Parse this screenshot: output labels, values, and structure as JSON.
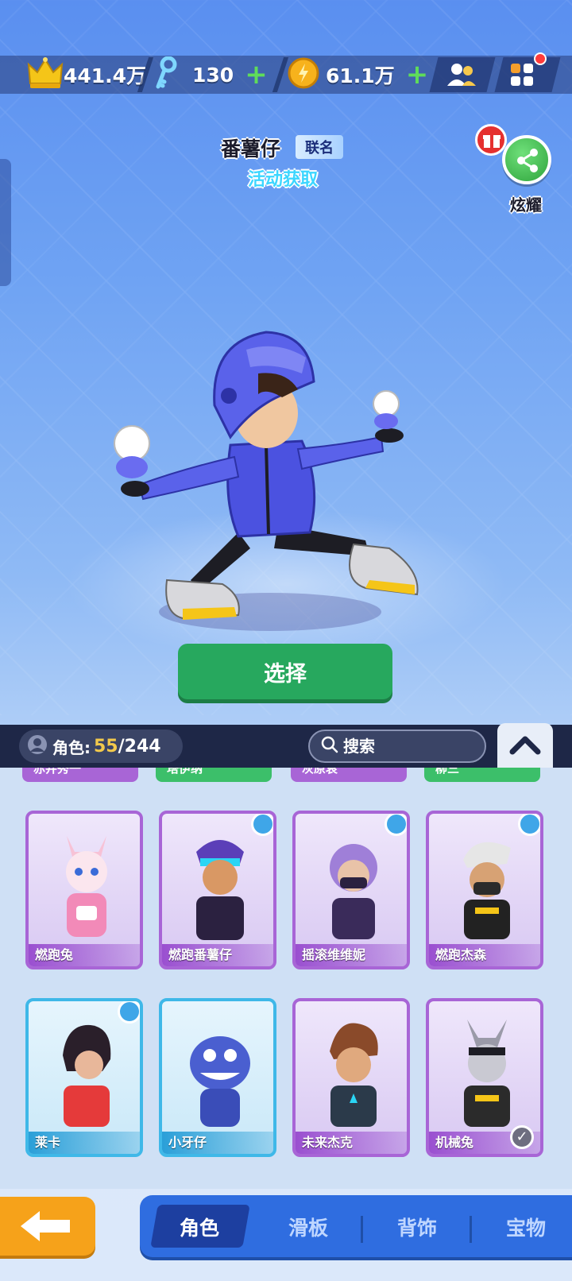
{
  "topbar": {
    "crown_score": "441.4万",
    "keys": "130",
    "coins": "61.1万",
    "add_symbol": "+"
  },
  "header": {
    "character_name": "番薯仔",
    "collab_tag": "联名",
    "obtain_method": "活动获取",
    "share_label": "炫耀"
  },
  "main": {
    "select_label": "选择"
  },
  "list": {
    "count_label": "角色:",
    "owned": "55",
    "total": "/244",
    "search_placeholder": "搜索",
    "partial_row": [
      "赤井秀一",
      "塔伊纳",
      "灰原哀",
      "柳三"
    ],
    "row1": [
      "燃跑兔",
      "燃跑番薯仔",
      "摇滚维维妮",
      "燃跑杰森"
    ],
    "row2": [
      "莱卡",
      "小牙仔",
      "未来杰克",
      "机械兔"
    ]
  },
  "nav": {
    "tabs": [
      "角色",
      "滑板",
      "背饰",
      "宝物"
    ],
    "active_tab": "角色"
  },
  "colors": {
    "accent_green": "#27a85e",
    "nav_blue": "#2f6de0",
    "back_orange": "#f6a21a",
    "epic_purple": "#a865d6",
    "rare_blue": "#3fb8e8",
    "count_gold": "#f2c94c"
  },
  "icons": [
    "crown-icon",
    "key-icon",
    "coin-icon",
    "friends-icon",
    "menu-icon",
    "share-icon",
    "gift-icon",
    "user-icon",
    "search-icon",
    "chevron-up-icon",
    "timer-icon",
    "check-icon",
    "back-arrow-icon"
  ]
}
